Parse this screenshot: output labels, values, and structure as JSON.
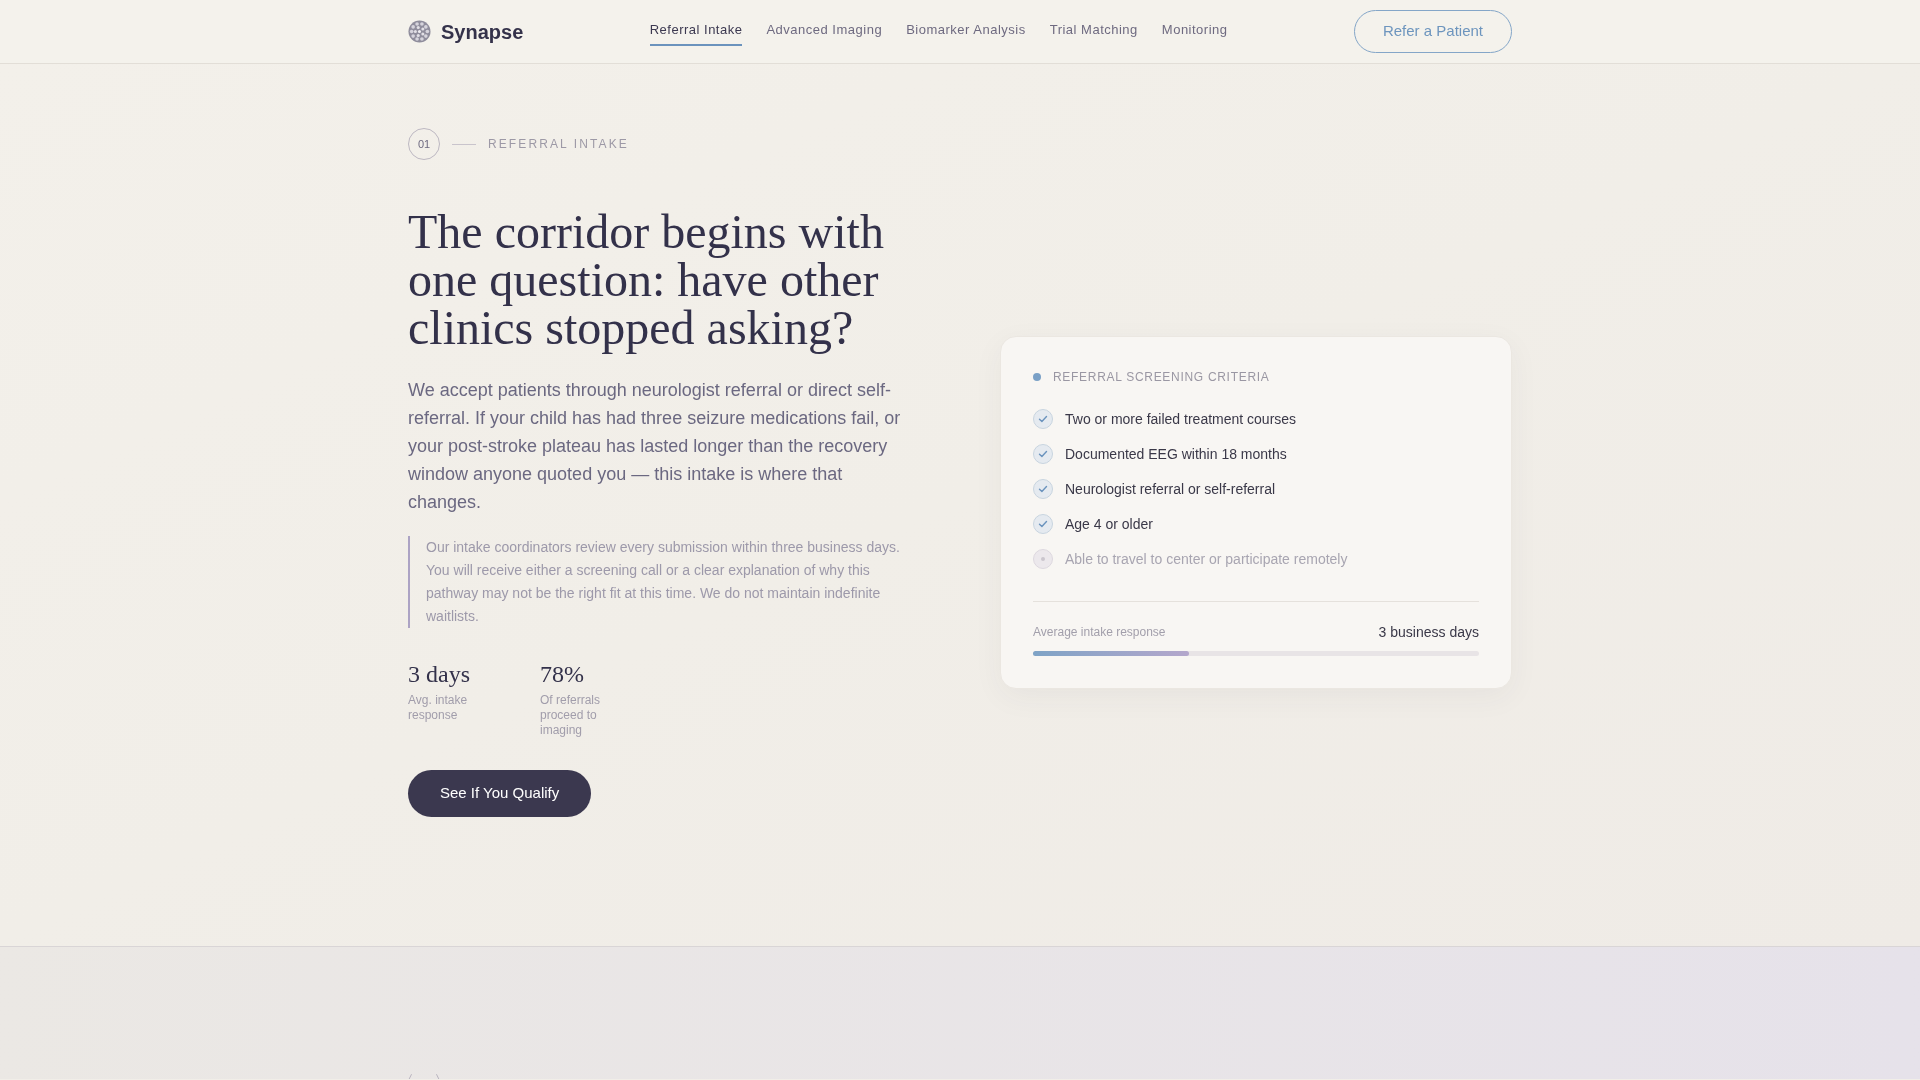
{
  "header": {
    "brand": "Synapse",
    "nav": [
      {
        "label": "Referral Intake",
        "selected": true
      },
      {
        "label": "Advanced Imaging",
        "selected": false
      },
      {
        "label": "Biomarker Analysis",
        "selected": false
      },
      {
        "label": "Trial Matching",
        "selected": false
      },
      {
        "label": "Monitoring",
        "selected": false
      }
    ],
    "cta": "Refer a Patient"
  },
  "hero": {
    "section_number": "01",
    "section_label": "REFERRAL INTAKE",
    "heading": "The corridor begins with one question: have other clinics stopped asking?",
    "body": "We accept patients through neurologist referral or direct self-referral. If your child has had three seizure medications fail, or your post-stroke plateau has lasted longer than the recovery window anyone quoted you — this intake is where that changes.",
    "note": "Our intake coordinators review every submission within three business days. You will receive either a screening call or a clear explanation of why this pathway may not be the right fit at this time. We do not maintain indefinite waitlists.",
    "stats": [
      {
        "value": "3 days",
        "label": "Avg. intake response"
      },
      {
        "value": "78%",
        "label": "Of referrals proceed to imaging"
      }
    ],
    "button": "See If You Qualify"
  },
  "criteria_card": {
    "title": "REFERRAL SCREENING CRITERIA",
    "items": [
      {
        "text": "Two or more failed treatment courses",
        "checked": true
      },
      {
        "text": "Documented EEG within 18 months",
        "checked": true
      },
      {
        "text": "Neurologist referral or self-referral",
        "checked": true
      },
      {
        "text": "Age 4 or older",
        "checked": true
      },
      {
        "text": "Able to travel to center or participate remotely",
        "checked": false
      }
    ],
    "metric": {
      "label": "Average intake response",
      "value": "3 business days",
      "level": 0.35
    }
  }
}
